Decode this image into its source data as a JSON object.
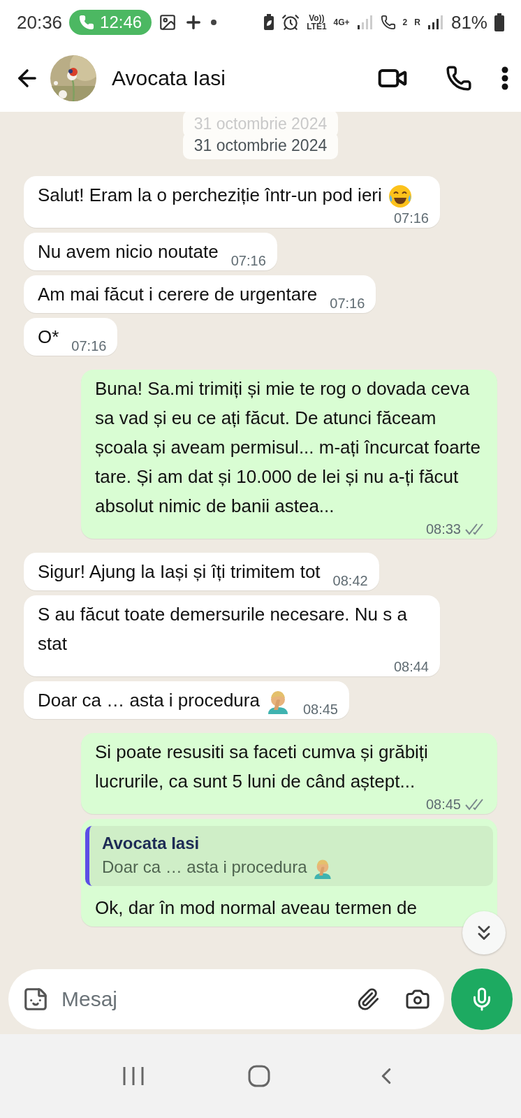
{
  "status_bar": {
    "time": "20:36",
    "call_timer": "12:46",
    "network_labels": [
      "Vo))",
      "LTE1",
      "4G+"
    ],
    "sim_labels": [
      "2",
      "R"
    ],
    "battery": "81%"
  },
  "header": {
    "contact": "Avocata Iasi"
  },
  "dates": [
    {
      "label": "31 octombrie 2024",
      "faded": true
    },
    {
      "label": "31 octombrie 2024",
      "faded": false
    }
  ],
  "messages": [
    {
      "kind": "received",
      "text": "Salut! Eram la o percheziție într-un pod ieri",
      "emoji": {
        "kind": "laugh"
      },
      "time": "07:16"
    },
    {
      "kind": "received",
      "text": "Nu avem nicio noutate",
      "time": "07:16"
    },
    {
      "kind": "received",
      "text": "Am mai făcut i cerere de urgentare",
      "time": "07:16"
    },
    {
      "kind": "received",
      "text": "O*",
      "time": "07:16"
    },
    {
      "kind": "sent",
      "text": "Buna! Sa.mi trimiți și mie te rog o dovada ceva sa vad și eu ce ați făcut. De atunci făceam școala și aveam permisul... m-ați încurcat foarte tare. Și am dat și 10.000 de lei și nu a-ți făcut absolut nimic de banii astea...",
      "time": "08:33",
      "read": false
    },
    {
      "kind": "received",
      "text": "Sigur! Ajung la Iași și îți trimitem tot",
      "time": "08:42"
    },
    {
      "kind": "received",
      "text": "S au făcut toate demersurile necesare. Nu s a stat",
      "time": "08:44"
    },
    {
      "kind": "received",
      "text": "Doar ca … asta i procedura",
      "emoji": {
        "kind": "facepalm"
      },
      "time": "08:45"
    },
    {
      "kind": "sent",
      "text": "Si poate resusiti sa faceti cumva și grăbiți lucrurile, ca sunt 5 luni de când aștept...",
      "time": "08:45",
      "read": false
    },
    {
      "kind": "reply",
      "quote_author": "Avocata Iasi",
      "quote_text": "Doar ca … asta i procedura",
      "quote_emoji": {
        "kind": "facepalm"
      },
      "text": "Ok, dar în mod normal aveau termen de"
    }
  ],
  "input": {
    "placeholder": "Mesaj"
  }
}
